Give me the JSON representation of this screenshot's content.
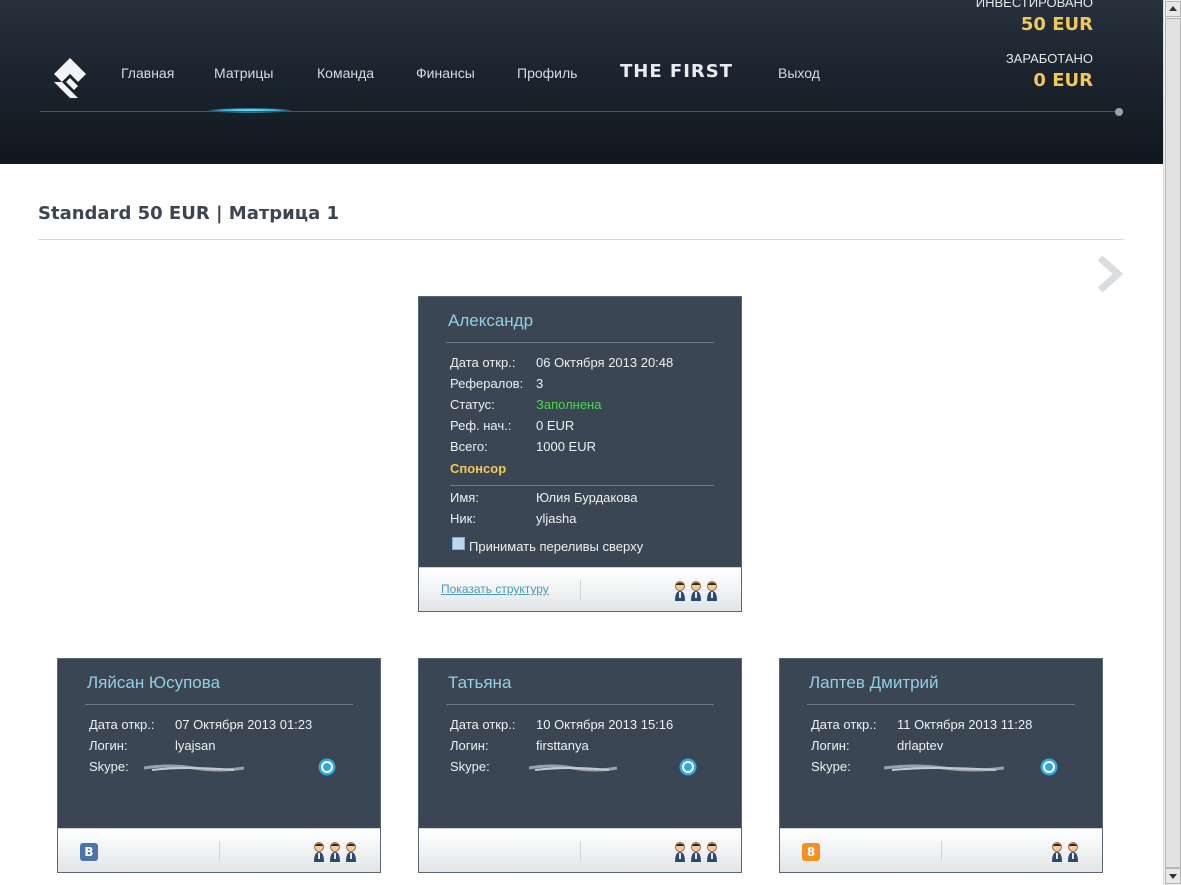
{
  "header": {
    "nav": [
      "Главная",
      "Матрицы",
      "Команда",
      "Финансы",
      "Профиль",
      "THE FIRST",
      "Выход"
    ],
    "invested_label": "ИНВЕСТИРОВАНО",
    "invested_value": "50 EUR",
    "earned_label": "ЗАРАБОТАНО",
    "earned_value": "0 EUR"
  },
  "page": {
    "title": "Standard 50 EUR | Матрица 1"
  },
  "main_card": {
    "name": "Александр",
    "fields": [
      {
        "label": "Дата откр.:",
        "value": "06 Октября 2013 20:48"
      },
      {
        "label": "Рефералов:",
        "value": "3"
      },
      {
        "label": "Статус:",
        "value": "Заполнена"
      },
      {
        "label": "Реф. нач.:",
        "value": "0 EUR"
      },
      {
        "label": "Всего:",
        "value": "1000 EUR"
      }
    ],
    "sponsor_heading": "Спонсор",
    "sponsor_fields": [
      {
        "label": "Имя:",
        "value": "Юлия Бурдакова"
      },
      {
        "label": "Ник:",
        "value": "yljasha"
      }
    ],
    "checkbox_label": "Принимать переливы сверху",
    "show_structure": "Показать структуру",
    "people_count": 3
  },
  "children": [
    {
      "name": "Ляйсан Юсупова",
      "fields": [
        {
          "label": "Дата откр.:",
          "value": "07 Октября 2013 01:23"
        },
        {
          "label": "Логин:",
          "value": "lyajsan"
        },
        {
          "label": "Skype:",
          "value": ""
        }
      ],
      "social": "vk",
      "social_text": "B",
      "people_count": 3
    },
    {
      "name": "Татьяна",
      "fields": [
        {
          "label": "Дата откр.:",
          "value": "10 Октября 2013 15:16"
        },
        {
          "label": "Логин:",
          "value": "firsttanya"
        },
        {
          "label": "Skype:",
          "value": ""
        }
      ],
      "social": "",
      "social_text": "",
      "people_count": 3
    },
    {
      "name": "Лаптев Дмитрий",
      "fields": [
        {
          "label": "Дата откр.:",
          "value": "11 Октября 2013 11:28"
        },
        {
          "label": "Логин:",
          "value": "drlaptev"
        },
        {
          "label": "Skype:",
          "value": ""
        }
      ],
      "social": "ok",
      "social_text": "8",
      "people_count": 2
    }
  ],
  "colors": {
    "accent_gold": "#f1c85a",
    "status_green": "#4cd64c",
    "card_bg": "#3a4654",
    "name_cyan": "#8fd0e6"
  }
}
